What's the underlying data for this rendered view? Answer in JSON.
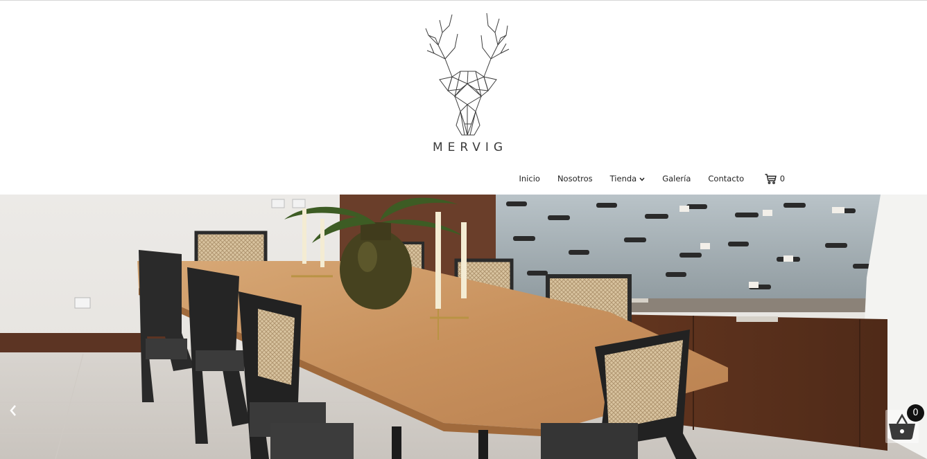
{
  "brand": {
    "name": "MERVIG",
    "logo_icon": "geometric-deer-head-icon"
  },
  "nav": {
    "items": [
      {
        "label": "Inicio"
      },
      {
        "label": "Nosotros"
      },
      {
        "label": "Tienda",
        "has_dropdown": true
      },
      {
        "label": "Galería"
      },
      {
        "label": "Contacto"
      }
    ],
    "cart_count": "0",
    "cart_icon": "cart-icon"
  },
  "hero": {
    "image": "dining-room-photo",
    "prev_icon": "chevron-left-icon"
  },
  "floating_basket": {
    "count": "0",
    "icon": "basket-icon"
  },
  "colors": {
    "text": "#222222",
    "badge_bg": "#111111",
    "wood": "#c8915d"
  }
}
